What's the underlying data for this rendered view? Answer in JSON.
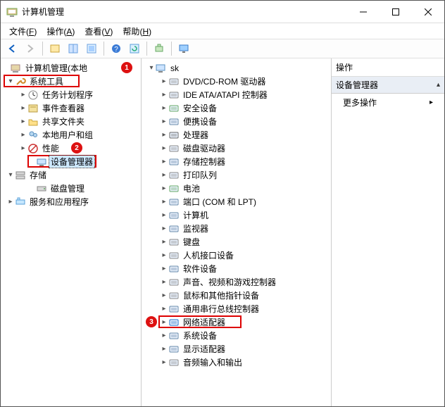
{
  "window": {
    "title": "计算机管理"
  },
  "menubar": {
    "file": {
      "label": "文件",
      "accel": "F"
    },
    "action": {
      "label": "操作",
      "accel": "A"
    },
    "view": {
      "label": "查看",
      "accel": "V"
    },
    "help": {
      "label": "帮助",
      "accel": "H"
    }
  },
  "left_tree": {
    "root": "计算机管理(本地",
    "systools": "系统工具",
    "tasksched": "任务计划程序",
    "eventvwr": "事件查看器",
    "shared": "共享文件夹",
    "localusers": "本地用户和组",
    "perf": "性能",
    "devmgr": "设备管理器",
    "storage": "存储",
    "diskmgmt": "磁盘管理",
    "services": "服务和应用程序"
  },
  "mid_tree": {
    "root": "sk",
    "items": [
      "DVD/CD-ROM 驱动器",
      "IDE ATA/ATAPI 控制器",
      "安全设备",
      "便携设备",
      "处理器",
      "磁盘驱动器",
      "存储控制器",
      "打印队列",
      "电池",
      "端口 (COM 和 LPT)",
      "计算机",
      "监视器",
      "键盘",
      "人机接口设备",
      "软件设备",
      "声音、视频和游戏控制器",
      "鼠标和其他指针设备",
      "通用串行总线控制器",
      "网络适配器",
      "系统设备",
      "显示适配器",
      "音频输入和输出"
    ]
  },
  "right_pane": {
    "header": "操作",
    "section": "设备管理器",
    "more": "更多操作"
  },
  "badges": {
    "b1": "1",
    "b2": "2",
    "b3": "3"
  }
}
